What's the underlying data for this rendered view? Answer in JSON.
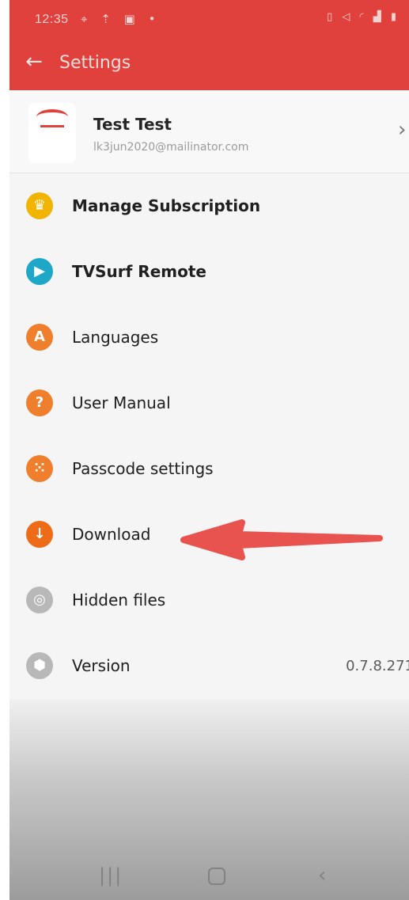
{
  "status_bar": {
    "time": "12:35",
    "left_icons": [
      "location-icon",
      "wifi-icon",
      "image-icon",
      "dot-icon"
    ],
    "right_icons": [
      "vibrate-icon",
      "mute-icon",
      "wifi-icon",
      "signal-icon",
      "battery-icon"
    ]
  },
  "header": {
    "title": "Settings",
    "back_icon": "back-arrow-icon",
    "color": "#e0413c"
  },
  "profile": {
    "name": "Test Test",
    "email": "lk3jun2020@mailinator.com"
  },
  "menu": [
    {
      "label": "Manage Subscription",
      "icon": "crown-icon",
      "color": "#f1b400",
      "bold": true
    },
    {
      "label": "TVSurf Remote",
      "icon": "tv-play-icon",
      "color": "#1fa7c8",
      "bold": true
    },
    {
      "label": "Languages",
      "icon": "language-icon",
      "color": "#ef7f2d",
      "bold": false
    },
    {
      "label": "User Manual",
      "icon": "manual-icon",
      "color": "#ef7f2d",
      "bold": false
    },
    {
      "label": "Passcode settings",
      "icon": "passcode-icon",
      "color": "#ef7f2d",
      "bold": false
    },
    {
      "label": "Download",
      "icon": "download-icon",
      "color": "#ee6b18",
      "bold": false
    },
    {
      "label": "Hidden files",
      "icon": "hidden-eye-icon",
      "color": "#b8b8b8",
      "bold": false
    },
    {
      "label": "Version",
      "icon": "version-icon",
      "color": "#b8b8b8",
      "bold": false
    }
  ],
  "version_value": "0.7.8.271",
  "annotation": {
    "type": "arrow",
    "color": "#e8524f",
    "points_to": "Download"
  },
  "nav_bar": {
    "icons": [
      "recent-apps-icon",
      "home-icon",
      "back-icon"
    ]
  }
}
